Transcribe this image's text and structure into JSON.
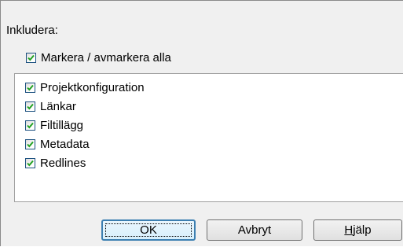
{
  "dialog": {
    "include_label": "Inkludera:",
    "select_all": {
      "label": "Markera / avmarkera alla",
      "checked": true
    },
    "items": [
      {
        "label": "Projektkonfiguration",
        "checked": true
      },
      {
        "label": "Länkar",
        "checked": true
      },
      {
        "label": "Filtillägg",
        "checked": true
      },
      {
        "label": "Metadata",
        "checked": true
      },
      {
        "label": "Redlines",
        "checked": true
      }
    ],
    "buttons": {
      "ok": "OK",
      "cancel": "Avbryt",
      "help_mnemonic": "H",
      "help_rest": "jälp"
    }
  }
}
